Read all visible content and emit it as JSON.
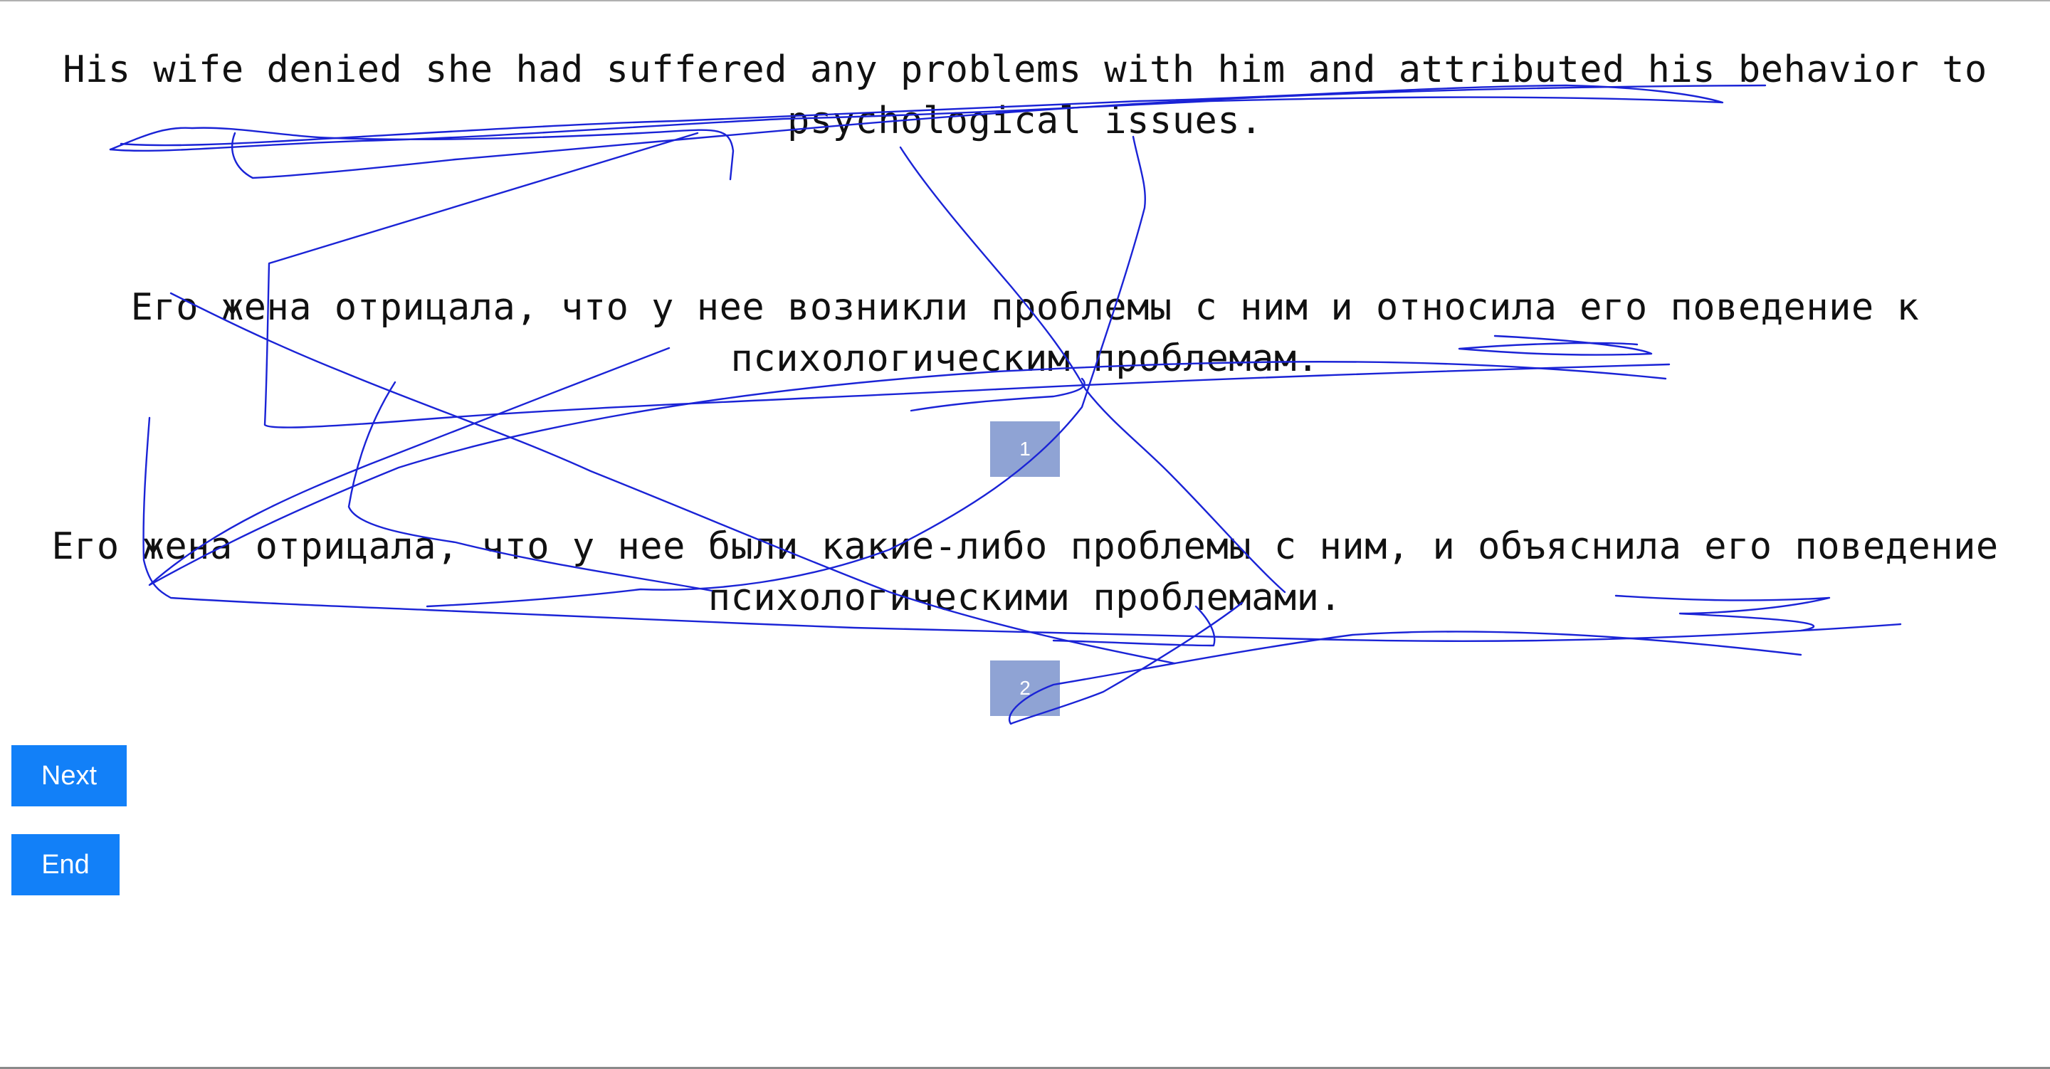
{
  "source_sentence": "His wife denied she had suffered any problems with him and attributed his behavior to psychological issues.",
  "translations": [
    {
      "text": "Его жена отрицала, что у нее возникли проблемы с ним и относила его поведение к психологическим проблемам.",
      "choice_label": "1"
    },
    {
      "text": "Его жена отрицала, что у нее были какие-либо проблемы с ним, и объяснила его поведение психологическими проблемами.",
      "choice_label": "2"
    }
  ],
  "buttons": {
    "next_label": "Next",
    "end_label": "End"
  },
  "colors": {
    "choice_button": "#8fa3d4",
    "action_button": "#1280f8",
    "scribble": "#1a23d6"
  }
}
